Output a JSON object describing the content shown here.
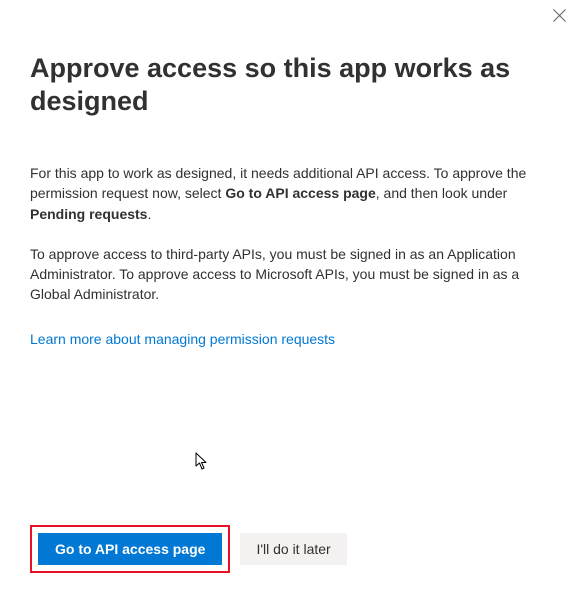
{
  "dialog": {
    "title": "Approve access so this app works as designed",
    "paragraph1_part1": "For this app to work as designed, it needs additional API access. To approve the permission request now, select ",
    "paragraph1_bold1": "Go to API access page",
    "paragraph1_part2": ", and then look under ",
    "paragraph1_bold2": "Pending requests",
    "paragraph1_part3": ".",
    "paragraph2": "To approve access to third-party APIs, you must be signed in as an Application Administrator. To approve access to Microsoft APIs, you must be signed in as a Global Administrator.",
    "link_text": "Learn more about managing permission requests",
    "primary_button": "Go to API access page",
    "secondary_button": "I'll do it later"
  }
}
